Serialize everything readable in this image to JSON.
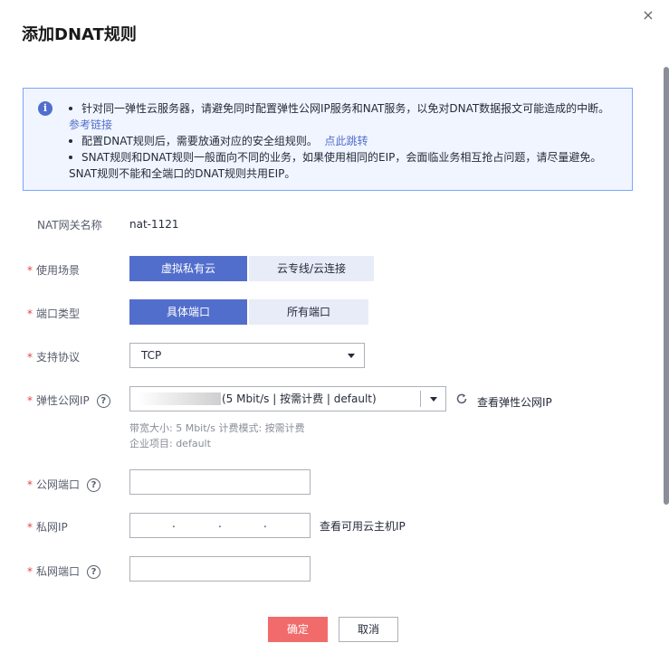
{
  "dialog": {
    "title": "添加DNAT规则",
    "close_label": "×"
  },
  "notice": {
    "icon_label": "i",
    "line1": "针对同一弹性云服务器，请避免同时配置弹性公网IP服务和NAT服务，以免对DNAT数据报文可能造成的中断。",
    "line1_link": "参考链接",
    "line2": "配置DNAT规则后，需要放通对应的安全组规则。",
    "line2_link": "点此跳转",
    "line3": "SNAT规则和DNAT规则一般面向不同的业务，如果使用相同的EIP，会面临业务相互抢占问题，请尽量避免。",
    "line3_cont": "SNAT规则不能和全端口的DNAT规则共用EIP。"
  },
  "form": {
    "nat_gateway_label": "NAT网关名称",
    "nat_gateway_value": "nat-1121",
    "required_mark": "*",
    "help_mark": "?",
    "scenario_label": "使用场景",
    "scenario_options": [
      "虚拟私有云",
      "云专线/云连接"
    ],
    "port_type_label": "端口类型",
    "port_type_options": [
      "具体端口",
      "所有端口"
    ],
    "protocol_label": "支持协议",
    "protocol_value": "TCP",
    "eip_label": "弹性公网IP",
    "eip_value": "(5 Mbit/s | 按需计费 | default)",
    "eip_view_link": "查看弹性公网IP",
    "eip_note_bandwidth": "带宽大小: 5 Mbit/s  计费模式: 按需计费",
    "eip_note_project": "企业项目: default",
    "public_port_label": "公网端口",
    "private_ip_label": "私网IP",
    "private_ip_separator": ".",
    "private_ip_view_link": "查看可用云主机IP",
    "private_port_label": "私网端口"
  },
  "footer": {
    "confirm_label": "确定",
    "cancel_label": "取消"
  },
  "colors": {
    "primary": "#526ecc",
    "confirm": "#f16b6b",
    "required": "#e54545"
  }
}
